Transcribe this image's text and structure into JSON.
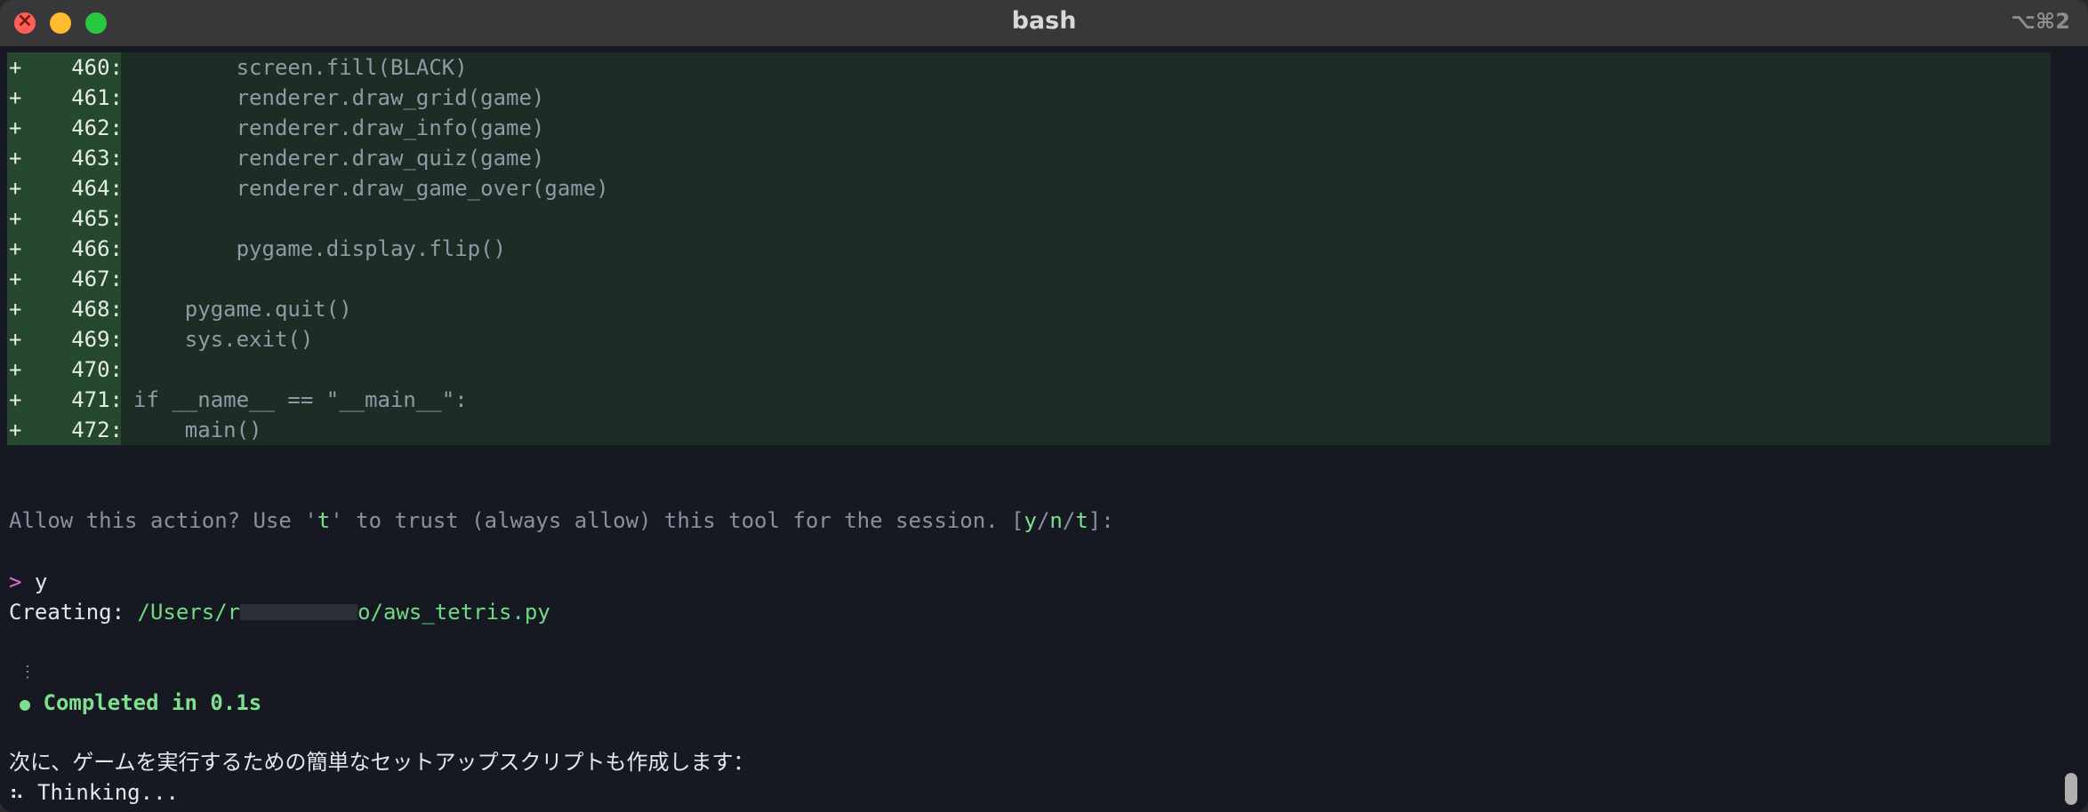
{
  "window": {
    "title": "bash",
    "shortcut": "⌥⌘2"
  },
  "diff": {
    "marker": "+",
    "rows": [
      {
        "num": "460:",
        "code": "        screen.fill(BLACK)"
      },
      {
        "num": "461:",
        "code": "        renderer.draw_grid(game)"
      },
      {
        "num": "462:",
        "code": "        renderer.draw_info(game)"
      },
      {
        "num": "463:",
        "code": "        renderer.draw_quiz(game)"
      },
      {
        "num": "464:",
        "code": "        renderer.draw_game_over(game)"
      },
      {
        "num": "465:",
        "code": ""
      },
      {
        "num": "466:",
        "code": "        pygame.display.flip()"
      },
      {
        "num": "467:",
        "code": ""
      },
      {
        "num": "468:",
        "code": "    pygame.quit()"
      },
      {
        "num": "469:",
        "code": "    sys.exit()"
      },
      {
        "num": "470:",
        "code": ""
      },
      {
        "num": "471:",
        "code": "if __name__ == \"__main__\":"
      },
      {
        "num": "472:",
        "code": "    main()"
      }
    ]
  },
  "prompt": {
    "text_before": "Allow this action? Use '",
    "trust_key": "t",
    "text_middle": "' to trust (always allow) this tool for the session. [",
    "opt_y": "y",
    "sep1": "/",
    "opt_n": "n",
    "sep2": "/",
    "opt_t": "t",
    "text_after": "]:"
  },
  "input": {
    "caret": ">",
    "answer": "y"
  },
  "creating": {
    "label": "Creating: ",
    "path_start": "/Users/r",
    "path_end": "o/aws_tetris.py"
  },
  "status": {
    "spinner": "⋮",
    "dot": "●",
    "completed": "Completed in 0.1s"
  },
  "message": "次に、ゲームを実行するための簡単なセットアップスクリプトも作成します：",
  "thinking": {
    "spinner": "⠦",
    "text": "Thinking..."
  }
}
